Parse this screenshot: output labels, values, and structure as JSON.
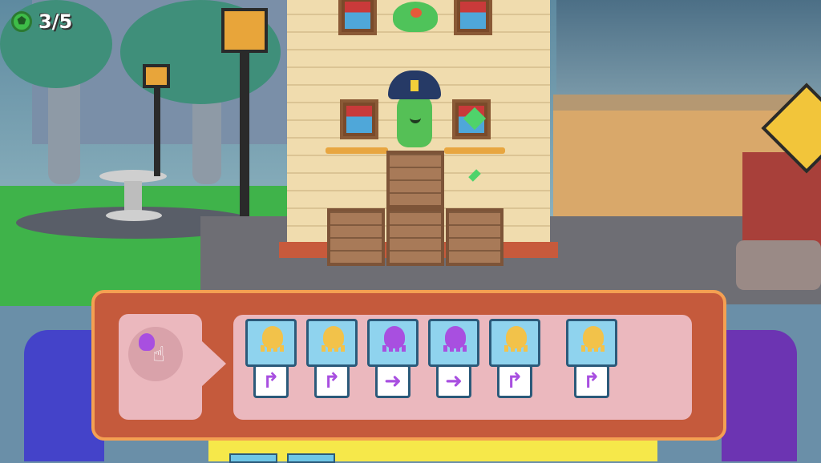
{
  "hud": {
    "gem_icon": "pentagon-gem-icon",
    "collected": 3,
    "total": 5,
    "counter_text": "3/5"
  },
  "source": {
    "icon": "purple-octopus-tap-icon"
  },
  "sequence": [
    {
      "creature": "orange-octopus",
      "command": "↱",
      "command_name": "turn-right-icon"
    },
    {
      "creature": "orange-octopus",
      "command": "↱",
      "command_name": "turn-right-icon"
    },
    {
      "creature": "purple-octopus",
      "command": "➜",
      "command_name": "move-forward-icon"
    },
    {
      "creature": "purple-octopus",
      "command": "➜",
      "command_name": "move-forward-icon"
    },
    {
      "creature": "orange-octopus",
      "command": "↱",
      "command_name": "turn-right-icon"
    },
    {
      "creature": "orange-octopus",
      "command": "↱",
      "command_name": "turn-right-icon"
    }
  ],
  "colors": {
    "panel": "#c55a3c",
    "panel_border": "#f4a052",
    "slot_bg": "#ebb8be",
    "orange_creature": "#f2c24a",
    "purple_creature": "#a84fe0",
    "card_bg": "#8fd3ee"
  }
}
